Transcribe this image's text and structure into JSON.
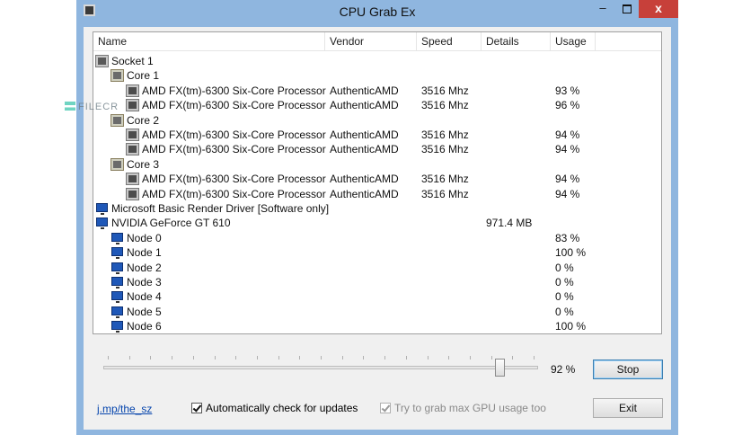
{
  "window": {
    "title": "CPU Grab Ex",
    "close_glyph": "x",
    "minimize_glyph": "–"
  },
  "watermark": {
    "text": "FILECR"
  },
  "list": {
    "columns": [
      "Name",
      "Vendor",
      "Speed",
      "Details",
      "Usage"
    ],
    "rows": [
      {
        "level": 0,
        "icon": "chip-icon",
        "name": "Socket 1",
        "vendor": "",
        "speed": "",
        "details": "",
        "usage": ""
      },
      {
        "level": 1,
        "icon": "core-icon",
        "name": "Core 1",
        "vendor": "",
        "speed": "",
        "details": "",
        "usage": ""
      },
      {
        "level": 2,
        "icon": "cpu-icon",
        "name": "AMD FX(tm)-6300 Six-Core Processor",
        "vendor": "AuthenticAMD",
        "speed": "3516 Mhz",
        "details": "",
        "usage": "93 %"
      },
      {
        "level": 2,
        "icon": "cpu-icon",
        "name": "AMD FX(tm)-6300 Six-Core Processor",
        "vendor": "AuthenticAMD",
        "speed": "3516 Mhz",
        "details": "",
        "usage": "96 %"
      },
      {
        "level": 1,
        "icon": "core-icon",
        "name": "Core 2",
        "vendor": "",
        "speed": "",
        "details": "",
        "usage": ""
      },
      {
        "level": 2,
        "icon": "cpu-icon",
        "name": "AMD FX(tm)-6300 Six-Core Processor",
        "vendor": "AuthenticAMD",
        "speed": "3516 Mhz",
        "details": "",
        "usage": "94 %"
      },
      {
        "level": 2,
        "icon": "cpu-icon",
        "name": "AMD FX(tm)-6300 Six-Core Processor",
        "vendor": "AuthenticAMD",
        "speed": "3516 Mhz",
        "details": "",
        "usage": "94 %"
      },
      {
        "level": 1,
        "icon": "core-icon",
        "name": "Core 3",
        "vendor": "",
        "speed": "",
        "details": "",
        "usage": ""
      },
      {
        "level": 2,
        "icon": "cpu-icon",
        "name": "AMD FX(tm)-6300 Six-Core Processor",
        "vendor": "AuthenticAMD",
        "speed": "3516 Mhz",
        "details": "",
        "usage": "94 %"
      },
      {
        "level": 2,
        "icon": "cpu-icon",
        "name": "AMD FX(tm)-6300 Six-Core Processor",
        "vendor": "AuthenticAMD",
        "speed": "3516 Mhz",
        "details": "",
        "usage": "94 %"
      },
      {
        "level": 0,
        "icon": "monitor-icon",
        "name": "Microsoft Basic Render Driver [Software only]",
        "vendor": "",
        "speed": "",
        "details": "",
        "usage": ""
      },
      {
        "level": 0,
        "icon": "monitor-icon",
        "name": "NVIDIA GeForce GT 610",
        "vendor": "",
        "speed": "",
        "details": "971.4 MB",
        "usage": ""
      },
      {
        "level": 1,
        "icon": "monitor-icon",
        "name": "Node 0",
        "vendor": "",
        "speed": "",
        "details": "",
        "usage": "83 %"
      },
      {
        "level": 1,
        "icon": "monitor-icon",
        "name": "Node 1",
        "vendor": "",
        "speed": "",
        "details": "",
        "usage": "100 %"
      },
      {
        "level": 1,
        "icon": "monitor-icon",
        "name": "Node 2",
        "vendor": "",
        "speed": "",
        "details": "",
        "usage": "0 %"
      },
      {
        "level": 1,
        "icon": "monitor-icon",
        "name": "Node 3",
        "vendor": "",
        "speed": "",
        "details": "",
        "usage": "0 %"
      },
      {
        "level": 1,
        "icon": "monitor-icon",
        "name": "Node 4",
        "vendor": "",
        "speed": "",
        "details": "",
        "usage": "0 %"
      },
      {
        "level": 1,
        "icon": "monitor-icon",
        "name": "Node 5",
        "vendor": "",
        "speed": "",
        "details": "",
        "usage": "0 %"
      },
      {
        "level": 1,
        "icon": "monitor-icon",
        "name": "Node 6",
        "vendor": "",
        "speed": "",
        "details": "",
        "usage": "100 %"
      }
    ]
  },
  "slider": {
    "value_label": "92 %",
    "level_percent": 92
  },
  "buttons": {
    "stop_label": "Stop",
    "exit_label": "Exit"
  },
  "footer": {
    "link_text": "j.mp/the_sz",
    "auto_update_label": "Automatically check for updates",
    "auto_update_checked": true,
    "max_gpu_label": "Try to grab max GPU usage too",
    "max_gpu_checked": true,
    "max_gpu_enabled": false
  }
}
